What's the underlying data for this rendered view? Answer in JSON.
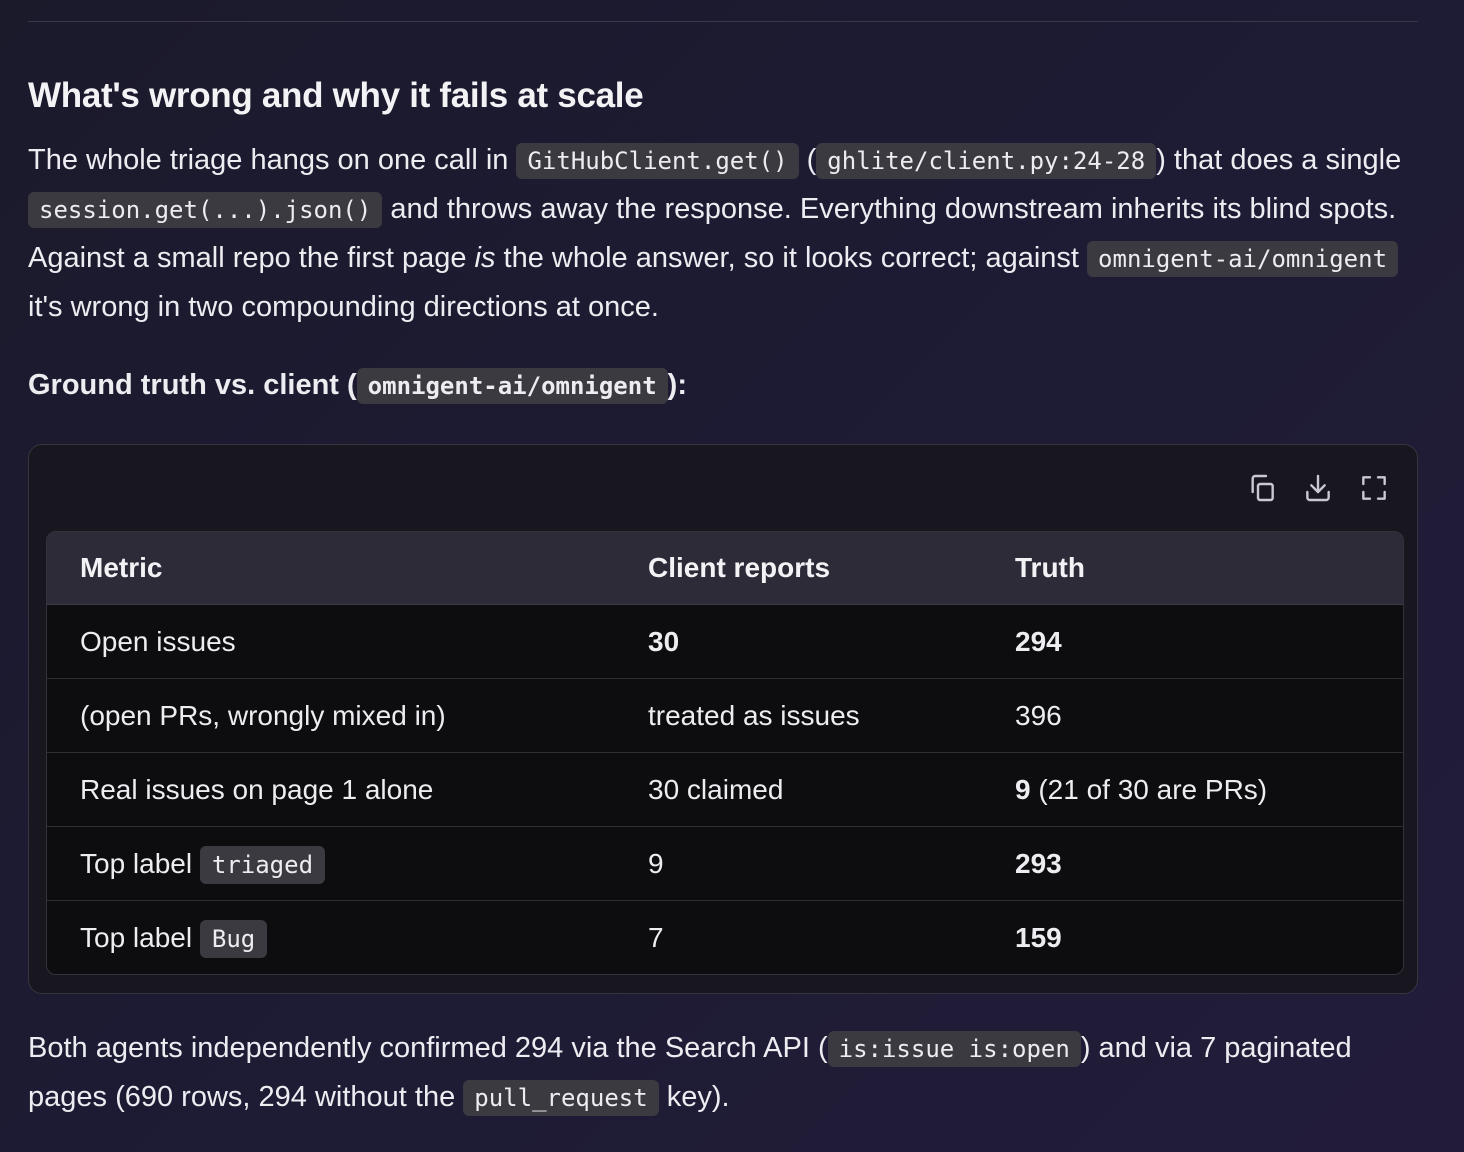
{
  "section": {
    "heading": "What's wrong and why it fails at scale"
  },
  "intro": {
    "t1": "The whole triage hangs on one call in ",
    "c1": "GitHubClient.get()",
    "t2": " (",
    "c2": "ghlite/client.py:24-28",
    "t3": ") that does a single ",
    "c3": "session.get(...).json()",
    "t4": " and throws away the response. Everything downstream inherits its blind spots. Against a small repo the first page ",
    "em": "is",
    "t5": " the whole answer, so it looks correct; against ",
    "c4": "omnigent-ai/omnigent",
    "t6": " it's wrong in two compounding directions at once."
  },
  "subheading": {
    "t1": "Ground truth vs. client (",
    "c1": "omnigent-ai/omnigent",
    "t2": "):"
  },
  "toolbar": {
    "copy_icon": "copy-icon",
    "download_icon": "download-icon",
    "expand_icon": "expand-icon"
  },
  "table": {
    "headers": [
      "Metric",
      "Client reports",
      "Truth"
    ],
    "rows": [
      {
        "metric": "Open issues",
        "metric_code": "",
        "client": "30",
        "truth": "294",
        "truth_extra": ""
      },
      {
        "metric": "(open PRs, wrongly mixed in)",
        "metric_code": "",
        "client": "treated as issues",
        "truth": "396",
        "truth_extra": ""
      },
      {
        "metric": "Real issues on page 1 alone",
        "metric_code": "",
        "client": "30 claimed",
        "truth": "9",
        "truth_extra": " (21 of 30 are PRs)"
      },
      {
        "metric": "Top label ",
        "metric_code": "triaged",
        "client": "9",
        "truth": "293",
        "truth_extra": ""
      },
      {
        "metric": "Top label ",
        "metric_code": "Bug",
        "client": "7",
        "truth": "159",
        "truth_extra": ""
      }
    ]
  },
  "closing": {
    "t1": "Both agents independently confirmed 294 via the Search API (",
    "c1": "is:issue is:open",
    "t2": ") and via 7 paginated pages (690 rows, 294 without the ",
    "c2": "pull_request",
    "t3": " key)."
  }
}
